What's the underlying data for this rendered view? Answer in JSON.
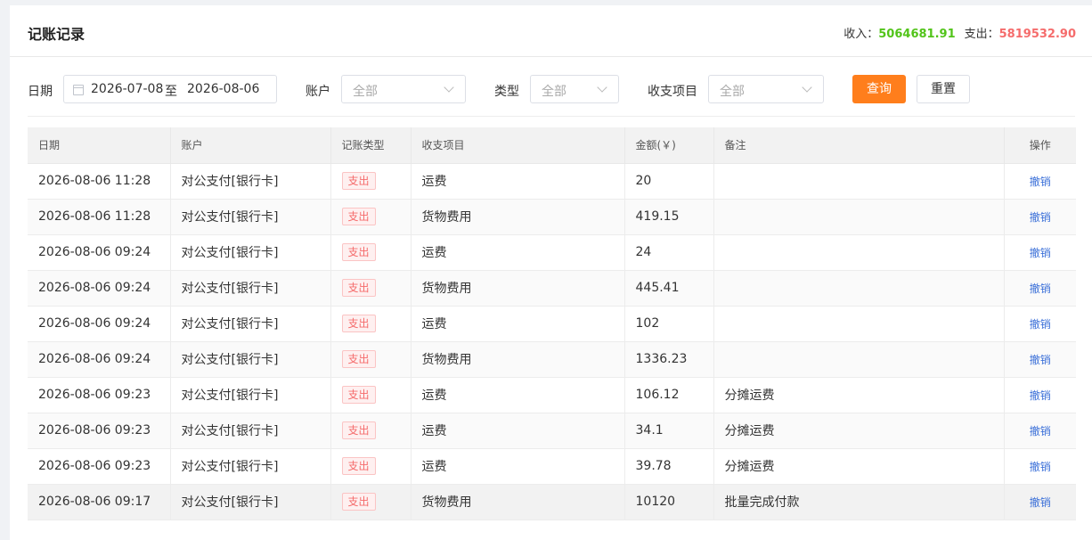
{
  "header": {
    "title": "记账记录",
    "income_label": "收入：",
    "income_value": "5064681.91",
    "expense_label": "支出：",
    "expense_value": "5819532.90",
    "income_color": "#52c41a",
    "expense_color": "#f56c6c"
  },
  "filters": {
    "date_label": "日期",
    "date_start": "2026-07-08",
    "date_separator": "至",
    "date_end": "2026-08-06",
    "account_label": "账户",
    "account_value": "全部",
    "type_label": "类型",
    "type_value": "全部",
    "item_label": "收支项目",
    "item_value": "全部",
    "query_label": "查询",
    "reset_label": "重置",
    "accent_color": "#ff7e1c"
  },
  "table": {
    "columns": [
      "日期",
      "账户",
      "记账类型",
      "收支项目",
      "金额(￥)",
      "备注",
      "操作"
    ],
    "rows": [
      {
        "date": "2026-08-06 11:28",
        "account": "对公支付[银行卡]",
        "type": "支出",
        "item": "运费",
        "amount": "20",
        "note": "",
        "action": "撤销"
      },
      {
        "date": "2026-08-06 11:28",
        "account": "对公支付[银行卡]",
        "type": "支出",
        "item": "货物费用",
        "amount": "419.15",
        "note": "",
        "action": "撤销"
      },
      {
        "date": "2026-08-06 09:24",
        "account": "对公支付[银行卡]",
        "type": "支出",
        "item": "运费",
        "amount": "24",
        "note": "",
        "action": "撤销"
      },
      {
        "date": "2026-08-06 09:24",
        "account": "对公支付[银行卡]",
        "type": "支出",
        "item": "货物费用",
        "amount": "445.41",
        "note": "",
        "action": "撤销"
      },
      {
        "date": "2026-08-06 09:24",
        "account": "对公支付[银行卡]",
        "type": "支出",
        "item": "运费",
        "amount": "102",
        "note": "",
        "action": "撤销"
      },
      {
        "date": "2026-08-06 09:24",
        "account": "对公支付[银行卡]",
        "type": "支出",
        "item": "货物费用",
        "amount": "1336.23",
        "note": "",
        "action": "撤销"
      },
      {
        "date": "2026-08-06 09:23",
        "account": "对公支付[银行卡]",
        "type": "支出",
        "item": "运费",
        "amount": "106.12",
        "note": "分摊运费",
        "action": "撤销"
      },
      {
        "date": "2026-08-06 09:23",
        "account": "对公支付[银行卡]",
        "type": "支出",
        "item": "运费",
        "amount": "34.1",
        "note": "分摊运费",
        "action": "撤销"
      },
      {
        "date": "2026-08-06 09:23",
        "account": "对公支付[银行卡]",
        "type": "支出",
        "item": "运费",
        "amount": "39.78",
        "note": "分摊运费",
        "action": "撤销"
      },
      {
        "date": "2026-08-06 09:17",
        "account": "对公支付[银行卡]",
        "type": "支出",
        "item": "货物费用",
        "amount": "10120",
        "note": "批量完成付款",
        "action": "撤销"
      }
    ]
  }
}
